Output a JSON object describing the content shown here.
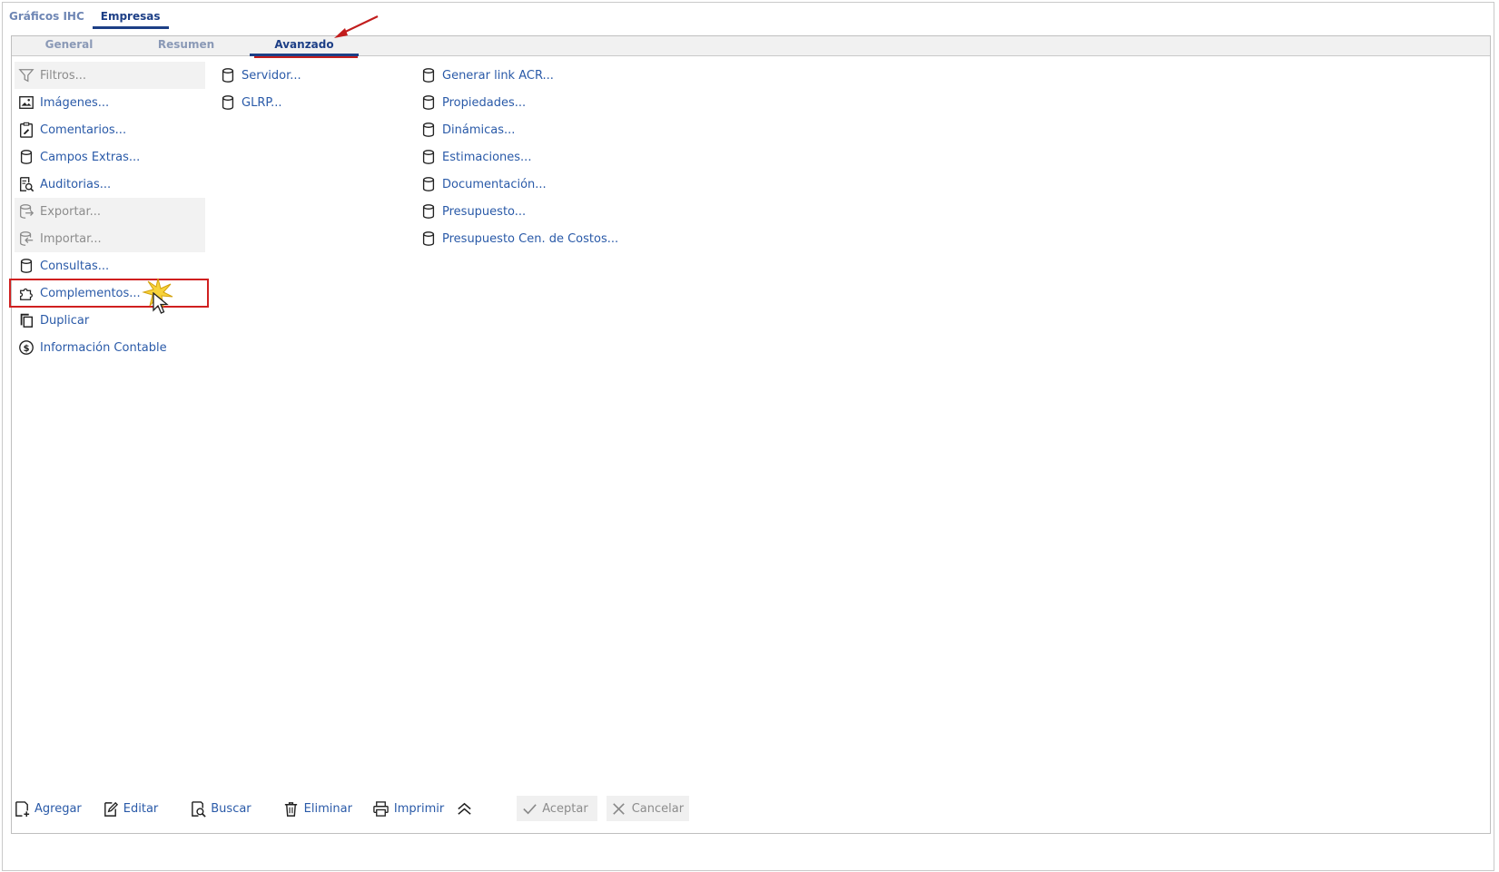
{
  "top_tabs": [
    {
      "label": "Gráficos IHC",
      "active": false
    },
    {
      "label": "Empresas",
      "active": true
    }
  ],
  "sub_tabs": [
    {
      "label": "General",
      "active": false
    },
    {
      "label": "Resumen",
      "active": false
    },
    {
      "label": "Avanzado",
      "active": true
    }
  ],
  "col1": [
    {
      "label": "Filtros...",
      "icon": "filter-icon",
      "enabled": false
    },
    {
      "label": "Imágenes...",
      "icon": "image-icon",
      "enabled": true
    },
    {
      "label": "Comentarios...",
      "icon": "clipboard-edit-icon",
      "enabled": true
    },
    {
      "label": "Campos Extras...",
      "icon": "database-icon",
      "enabled": true
    },
    {
      "label": "Auditorias...",
      "icon": "audit-search-icon",
      "enabled": true
    },
    {
      "label": "Exportar...",
      "icon": "database-export-icon",
      "enabled": false
    },
    {
      "label": "Importar...",
      "icon": "database-import-icon",
      "enabled": false
    },
    {
      "label": "Consultas...",
      "icon": "database-icon",
      "enabled": true
    },
    {
      "label": "Complementos...",
      "icon": "puzzle-icon",
      "enabled": true
    },
    {
      "label": "Duplicar",
      "icon": "copy-icon",
      "enabled": true
    },
    {
      "label": "Información Contable",
      "icon": "dollar-circle-icon",
      "enabled": true
    }
  ],
  "col2": [
    {
      "label": "Servidor...",
      "icon": "database-icon",
      "enabled": true
    },
    {
      "label": "GLRP...",
      "icon": "database-icon",
      "enabled": true
    }
  ],
  "col3": [
    {
      "label": "Generar link ACR...",
      "icon": "database-icon",
      "enabled": true
    },
    {
      "label": "Propiedades...",
      "icon": "database-icon",
      "enabled": true
    },
    {
      "label": "Dinámicas...",
      "icon": "database-icon",
      "enabled": true
    },
    {
      "label": "Estimaciones...",
      "icon": "database-icon",
      "enabled": true
    },
    {
      "label": "Documentación...",
      "icon": "database-icon",
      "enabled": true
    },
    {
      "label": "Presupuesto...",
      "icon": "database-icon",
      "enabled": true
    },
    {
      "label": "Presupuesto Cen. de Costos...",
      "icon": "database-icon",
      "enabled": true
    }
  ],
  "toolbar": [
    {
      "label": "Agregar",
      "icon": "add-doc-icon",
      "enabled": true
    },
    {
      "label": "Editar",
      "icon": "edit-icon",
      "enabled": true
    },
    {
      "label": "Buscar",
      "icon": "search-doc-icon",
      "enabled": true
    },
    {
      "label": "Eliminar",
      "icon": "trash-icon",
      "enabled": true
    },
    {
      "label": "Imprimir",
      "icon": "print-icon",
      "enabled": true
    },
    {
      "label": "",
      "icon": "chevrons-up-icon",
      "enabled": true
    },
    {
      "label": "Aceptar",
      "icon": "check-icon",
      "enabled": false
    },
    {
      "label": "Cancelar",
      "icon": "x-icon",
      "enabled": false
    }
  ],
  "colors": {
    "link": "#2a5aa8",
    "active_tab": "#1d3f86",
    "annotation": "#c21d1d",
    "disabled_text": "#8c8c8c"
  }
}
